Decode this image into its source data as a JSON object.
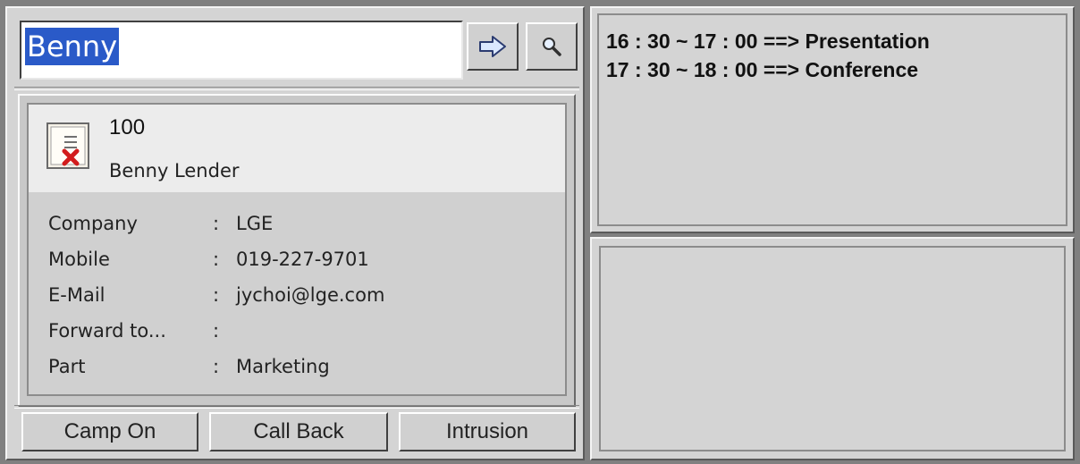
{
  "search": {
    "value": "Benny"
  },
  "toolbar": {
    "forward_icon": "arrow-right-icon",
    "search_icon": "magnifier-icon"
  },
  "contact": {
    "number": "100",
    "name": "Benny Lender",
    "icon": "contact-card-error-icon",
    "fields": [
      {
        "label": "Company",
        "value": "LGE"
      },
      {
        "label": "Mobile",
        "value": "019-227-9701"
      },
      {
        "label": "E-Mail",
        "value": "jychoi@lge.com"
      },
      {
        "label": "Forward to...",
        "value": ""
      },
      {
        "label": "Part",
        "value": "Marketing"
      }
    ]
  },
  "actions": {
    "camp_on": "Camp On",
    "call_back": "Call Back",
    "intrusion": "Intrusion"
  },
  "schedule": [
    "16 : 30 ~ 17 : 00 ==> Presentation",
    "17 : 30 ~ 18 : 00 ==> Conference"
  ],
  "colors": {
    "background": "#808080",
    "panel": "#d4d4d4",
    "selection": "#2a5ac8",
    "card_header": "#ececec"
  }
}
